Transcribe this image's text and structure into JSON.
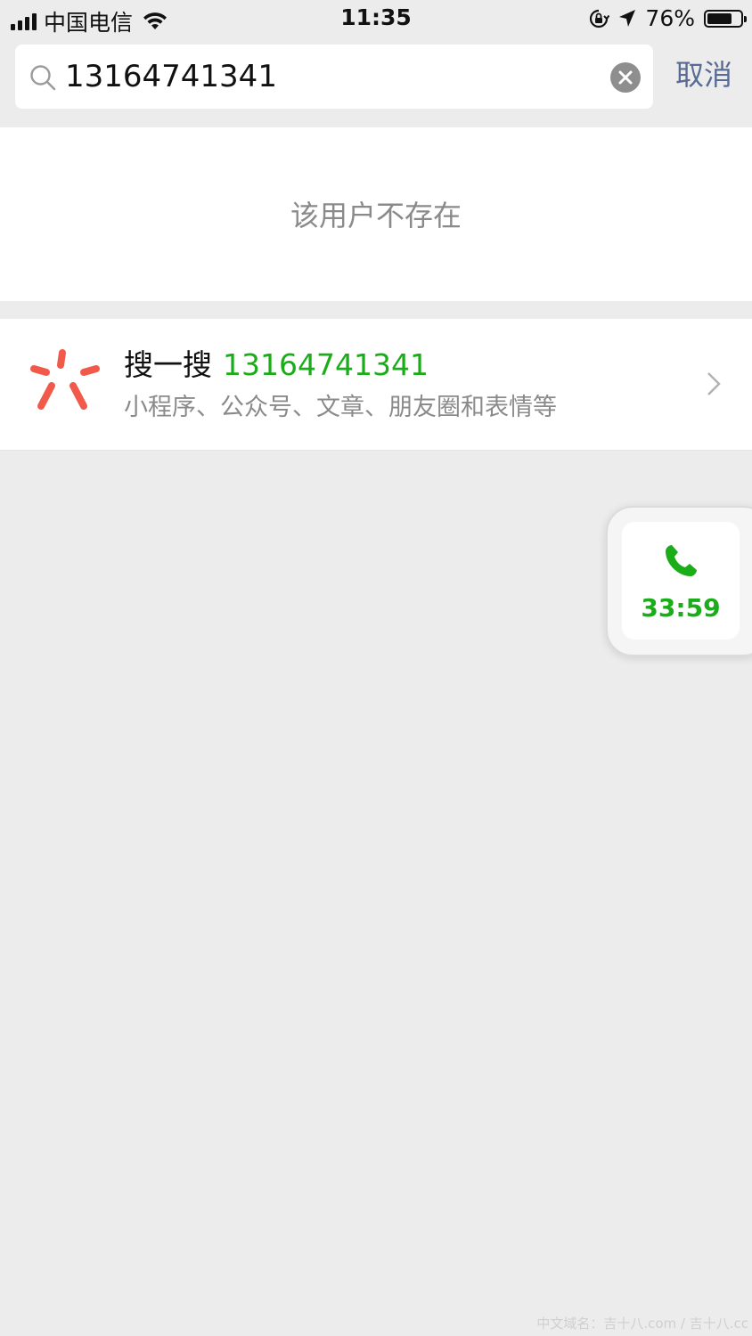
{
  "status_bar": {
    "carrier": "中国电信",
    "time": "11:35",
    "battery_percent": "76%",
    "battery_level": 0.76,
    "icons": [
      "signal-icon",
      "wifi-icon",
      "orientation-lock-icon",
      "location-icon",
      "battery-icon"
    ]
  },
  "search": {
    "query": "13164741341",
    "cancel_label": "取消",
    "icons": [
      "search-icon",
      "clear-icon"
    ]
  },
  "result": {
    "not_found_text": "该用户不存在"
  },
  "souyisou": {
    "keyword": "搜一搜",
    "query": "13164741341",
    "subtitle": "小程序、公众号、文章、朋友圈和表情等",
    "icon": "souyisou-logo-icon",
    "accent_color": "#f15a4a"
  },
  "floating_call": {
    "timer": "33:59",
    "icon": "phone-icon",
    "color": "#1aad19"
  },
  "watermark": {
    "text": "中文域名：吉十八.com / 吉十八.cc"
  }
}
